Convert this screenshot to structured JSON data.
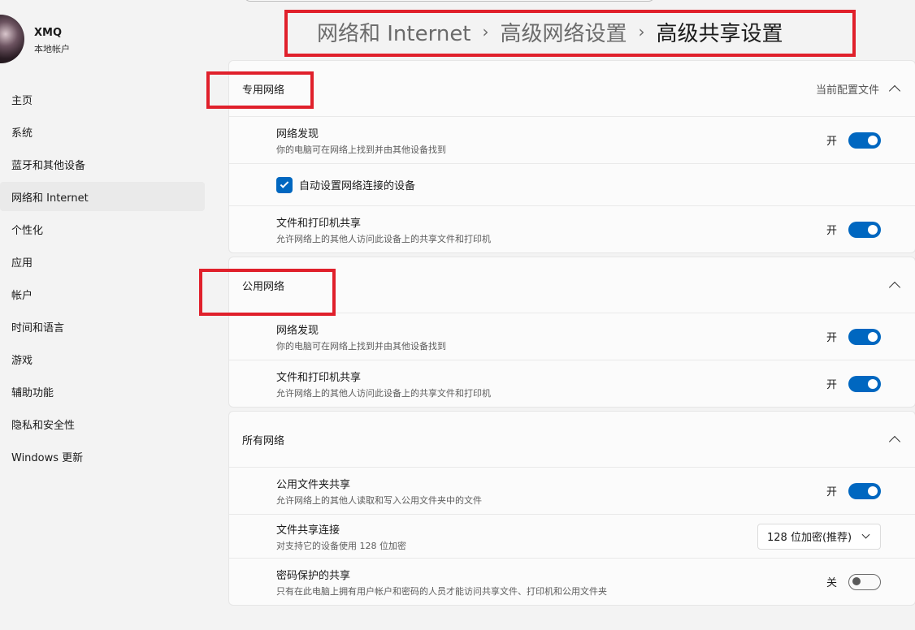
{
  "profile": {
    "name": "XMQ",
    "subtitle": "本地帐户"
  },
  "nav": {
    "items": [
      {
        "label": "主页"
      },
      {
        "label": "系统"
      },
      {
        "label": "蓝牙和其他设备"
      },
      {
        "label": "网络和 Internet"
      },
      {
        "label": "个性化"
      },
      {
        "label": "应用"
      },
      {
        "label": "帐户"
      },
      {
        "label": "时间和语言"
      },
      {
        "label": "游戏"
      },
      {
        "label": "辅助功能"
      },
      {
        "label": "隐私和安全性"
      },
      {
        "label": "Windows 更新"
      }
    ]
  },
  "breadcrumb": {
    "items": [
      "网络和 Internet",
      "高级网络设置",
      "高级共享设置"
    ],
    "separator": "›"
  },
  "private_network": {
    "title": "专用网络",
    "status": "当前配置文件",
    "discovery": {
      "title": "网络发现",
      "desc": "你的电脑可在网络上找到并由其他设备找到",
      "state": "开"
    },
    "auto_setup": {
      "label": "自动设置网络连接的设备",
      "checked": true
    },
    "file_sharing": {
      "title": "文件和打印机共享",
      "desc": "允许网络上的其他人访问此设备上的共享文件和打印机",
      "state": "开"
    }
  },
  "public_network": {
    "title": "公用网络",
    "discovery": {
      "title": "网络发现",
      "desc": "你的电脑可在网络上找到并由其他设备找到",
      "state": "开"
    },
    "file_sharing": {
      "title": "文件和打印机共享",
      "desc": "允许网络上的其他人访问此设备上的共享文件和打印机",
      "state": "开"
    }
  },
  "all_networks": {
    "title": "所有网络",
    "public_folder": {
      "title": "公用文件夹共享",
      "desc": "允许网络上的其他人读取和写入公用文件夹中的文件",
      "state": "开"
    },
    "file_sharing_conn": {
      "title": "文件共享连接",
      "desc": "对支持它的设备使用 128 位加密",
      "value": "128 位加密(推荐)"
    },
    "password_sharing": {
      "title": "密码保护的共享",
      "desc": "只有在此电脑上拥有用户帐户和密码的人员才能访问共享文件、打印机和公用文件夹",
      "state": "关"
    }
  },
  "colors": {
    "accent": "#0067c0",
    "highlight_box": "#e0202b",
    "background": "#f3f3f3"
  }
}
